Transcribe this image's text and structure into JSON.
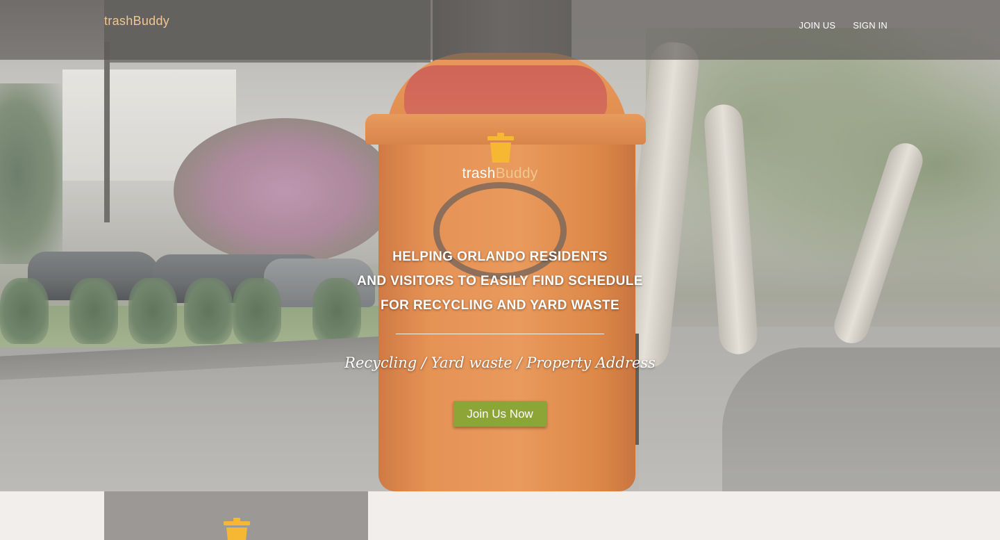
{
  "nav": {
    "brand_part1": "trash",
    "brand_part2": "Buddy",
    "links": [
      "JOIN US",
      "SIGN IN"
    ]
  },
  "hero": {
    "logo_part1": "trash",
    "logo_part2": "Buddy",
    "headline_lines": [
      "HELPING ORLANDO RESIDENTS",
      "AND VISITORS TO EASILY FIND SCHEDULE",
      "FOR RECYCLING AND YARD WASTE"
    ],
    "tagline": "Recycling / Yard waste / Property Address",
    "cta_label": "Join Us Now"
  },
  "icons": {
    "logo": "trash-bin-icon",
    "section": "trash-bin-icon"
  },
  "colors": {
    "brand_accent": "#f1c690",
    "icon_yellow": "#f6b833",
    "cta_green": "#8da436",
    "nav_bar": "#555250",
    "lower_card": "#9b9896",
    "lower_bg": "#f1eeeb"
  }
}
